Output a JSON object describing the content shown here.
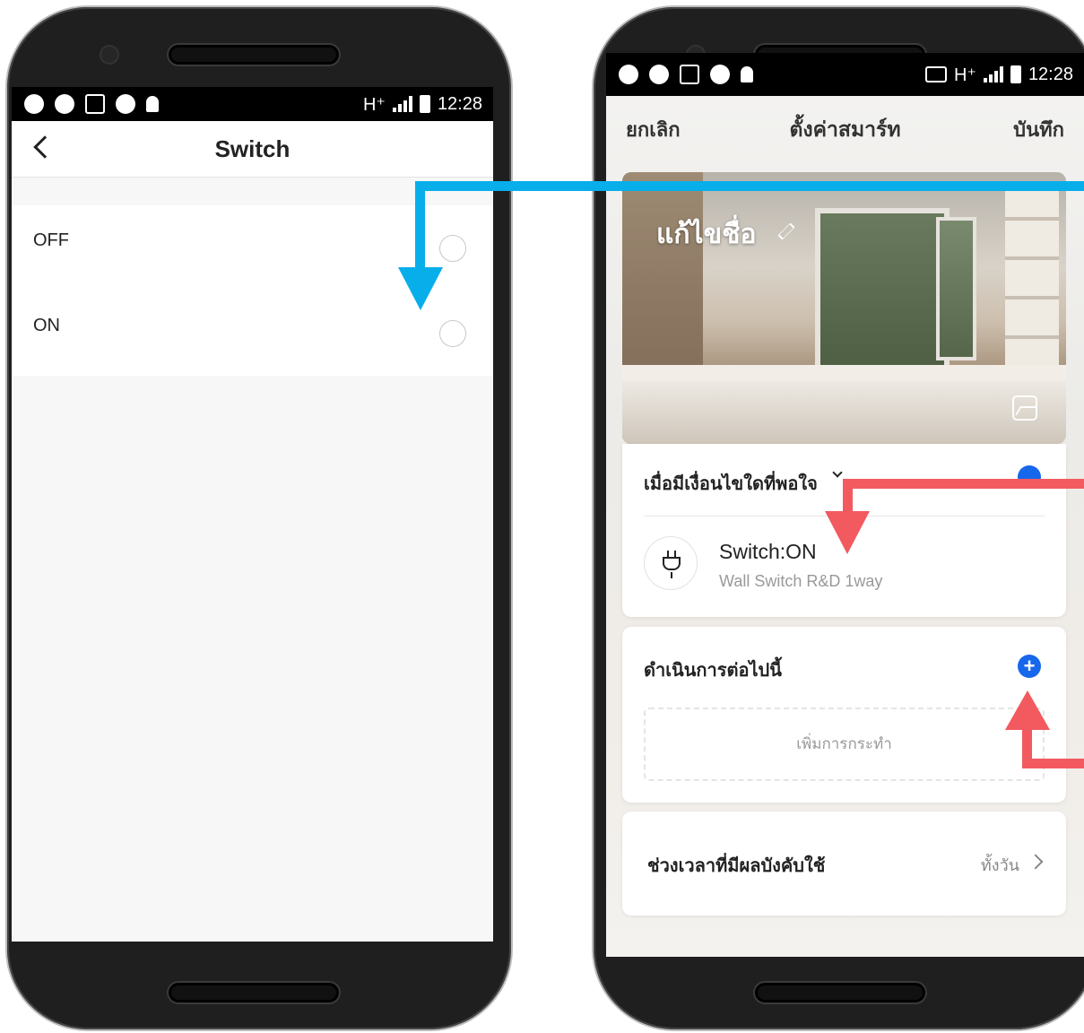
{
  "left_phone": {
    "status_time": "12:28",
    "status_network": "H⁺",
    "title": "Switch",
    "options": [
      {
        "label": "OFF",
        "selected": false
      },
      {
        "label": "ON",
        "selected": false
      }
    ]
  },
  "right_phone": {
    "status_time": "12:28",
    "status_network": "H⁺",
    "nav": {
      "cancel": "ยกเลิก",
      "title": "ตั้งค่าสมาร์ท",
      "save": "บันทึก"
    },
    "hero": {
      "edit_name": "แก้ไขชื่อ"
    },
    "condition": {
      "title": "เมื่อมีเงื่อนไขใดที่พอใจ",
      "item_main": "Switch:ON",
      "item_sub": "Wall Switch R&D 1way"
    },
    "action": {
      "title": "ดำเนินการต่อไปนี้",
      "add_placeholder": "เพิ่มการกระทำ",
      "add_symbol": "+"
    },
    "time": {
      "label": "ช่วงเวลาที่มีผลบังคับใช้",
      "value": "ทั้งวัน"
    }
  },
  "colors": {
    "accent_blue": "#1767ec",
    "arrow_blue": "#08aeea",
    "arrow_red": "#f25a60"
  }
}
